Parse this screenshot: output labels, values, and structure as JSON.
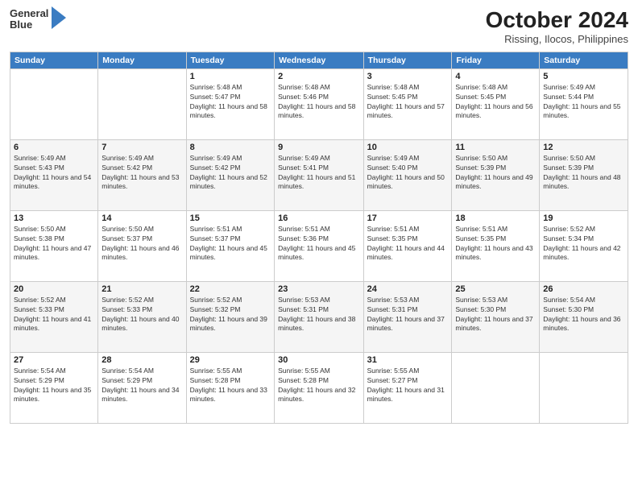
{
  "logo": {
    "line1": "General",
    "line2": "Blue"
  },
  "header": {
    "month": "October 2024",
    "location": "Rissing, Ilocos, Philippines"
  },
  "weekdays": [
    "Sunday",
    "Monday",
    "Tuesday",
    "Wednesday",
    "Thursday",
    "Friday",
    "Saturday"
  ],
  "weeks": [
    [
      {
        "day": "",
        "sunrise": "",
        "sunset": "",
        "daylight": ""
      },
      {
        "day": "",
        "sunrise": "",
        "sunset": "",
        "daylight": ""
      },
      {
        "day": "1",
        "sunrise": "Sunrise: 5:48 AM",
        "sunset": "Sunset: 5:47 PM",
        "daylight": "Daylight: 11 hours and 58 minutes."
      },
      {
        "day": "2",
        "sunrise": "Sunrise: 5:48 AM",
        "sunset": "Sunset: 5:46 PM",
        "daylight": "Daylight: 11 hours and 58 minutes."
      },
      {
        "day": "3",
        "sunrise": "Sunrise: 5:48 AM",
        "sunset": "Sunset: 5:45 PM",
        "daylight": "Daylight: 11 hours and 57 minutes."
      },
      {
        "day": "4",
        "sunrise": "Sunrise: 5:48 AM",
        "sunset": "Sunset: 5:45 PM",
        "daylight": "Daylight: 11 hours and 56 minutes."
      },
      {
        "day": "5",
        "sunrise": "Sunrise: 5:49 AM",
        "sunset": "Sunset: 5:44 PM",
        "daylight": "Daylight: 11 hours and 55 minutes."
      }
    ],
    [
      {
        "day": "6",
        "sunrise": "Sunrise: 5:49 AM",
        "sunset": "Sunset: 5:43 PM",
        "daylight": "Daylight: 11 hours and 54 minutes."
      },
      {
        "day": "7",
        "sunrise": "Sunrise: 5:49 AM",
        "sunset": "Sunset: 5:42 PM",
        "daylight": "Daylight: 11 hours and 53 minutes."
      },
      {
        "day": "8",
        "sunrise": "Sunrise: 5:49 AM",
        "sunset": "Sunset: 5:42 PM",
        "daylight": "Daylight: 11 hours and 52 minutes."
      },
      {
        "day": "9",
        "sunrise": "Sunrise: 5:49 AM",
        "sunset": "Sunset: 5:41 PM",
        "daylight": "Daylight: 11 hours and 51 minutes."
      },
      {
        "day": "10",
        "sunrise": "Sunrise: 5:49 AM",
        "sunset": "Sunset: 5:40 PM",
        "daylight": "Daylight: 11 hours and 50 minutes."
      },
      {
        "day": "11",
        "sunrise": "Sunrise: 5:50 AM",
        "sunset": "Sunset: 5:39 PM",
        "daylight": "Daylight: 11 hours and 49 minutes."
      },
      {
        "day": "12",
        "sunrise": "Sunrise: 5:50 AM",
        "sunset": "Sunset: 5:39 PM",
        "daylight": "Daylight: 11 hours and 48 minutes."
      }
    ],
    [
      {
        "day": "13",
        "sunrise": "Sunrise: 5:50 AM",
        "sunset": "Sunset: 5:38 PM",
        "daylight": "Daylight: 11 hours and 47 minutes."
      },
      {
        "day": "14",
        "sunrise": "Sunrise: 5:50 AM",
        "sunset": "Sunset: 5:37 PM",
        "daylight": "Daylight: 11 hours and 46 minutes."
      },
      {
        "day": "15",
        "sunrise": "Sunrise: 5:51 AM",
        "sunset": "Sunset: 5:37 PM",
        "daylight": "Daylight: 11 hours and 45 minutes."
      },
      {
        "day": "16",
        "sunrise": "Sunrise: 5:51 AM",
        "sunset": "Sunset: 5:36 PM",
        "daylight": "Daylight: 11 hours and 45 minutes."
      },
      {
        "day": "17",
        "sunrise": "Sunrise: 5:51 AM",
        "sunset": "Sunset: 5:35 PM",
        "daylight": "Daylight: 11 hours and 44 minutes."
      },
      {
        "day": "18",
        "sunrise": "Sunrise: 5:51 AM",
        "sunset": "Sunset: 5:35 PM",
        "daylight": "Daylight: 11 hours and 43 minutes."
      },
      {
        "day": "19",
        "sunrise": "Sunrise: 5:52 AM",
        "sunset": "Sunset: 5:34 PM",
        "daylight": "Daylight: 11 hours and 42 minutes."
      }
    ],
    [
      {
        "day": "20",
        "sunrise": "Sunrise: 5:52 AM",
        "sunset": "Sunset: 5:33 PM",
        "daylight": "Daylight: 11 hours and 41 minutes."
      },
      {
        "day": "21",
        "sunrise": "Sunrise: 5:52 AM",
        "sunset": "Sunset: 5:33 PM",
        "daylight": "Daylight: 11 hours and 40 minutes."
      },
      {
        "day": "22",
        "sunrise": "Sunrise: 5:52 AM",
        "sunset": "Sunset: 5:32 PM",
        "daylight": "Daylight: 11 hours and 39 minutes."
      },
      {
        "day": "23",
        "sunrise": "Sunrise: 5:53 AM",
        "sunset": "Sunset: 5:31 PM",
        "daylight": "Daylight: 11 hours and 38 minutes."
      },
      {
        "day": "24",
        "sunrise": "Sunrise: 5:53 AM",
        "sunset": "Sunset: 5:31 PM",
        "daylight": "Daylight: 11 hours and 37 minutes."
      },
      {
        "day": "25",
        "sunrise": "Sunrise: 5:53 AM",
        "sunset": "Sunset: 5:30 PM",
        "daylight": "Daylight: 11 hours and 37 minutes."
      },
      {
        "day": "26",
        "sunrise": "Sunrise: 5:54 AM",
        "sunset": "Sunset: 5:30 PM",
        "daylight": "Daylight: 11 hours and 36 minutes."
      }
    ],
    [
      {
        "day": "27",
        "sunrise": "Sunrise: 5:54 AM",
        "sunset": "Sunset: 5:29 PM",
        "daylight": "Daylight: 11 hours and 35 minutes."
      },
      {
        "day": "28",
        "sunrise": "Sunrise: 5:54 AM",
        "sunset": "Sunset: 5:29 PM",
        "daylight": "Daylight: 11 hours and 34 minutes."
      },
      {
        "day": "29",
        "sunrise": "Sunrise: 5:55 AM",
        "sunset": "Sunset: 5:28 PM",
        "daylight": "Daylight: 11 hours and 33 minutes."
      },
      {
        "day": "30",
        "sunrise": "Sunrise: 5:55 AM",
        "sunset": "Sunset: 5:28 PM",
        "daylight": "Daylight: 11 hours and 32 minutes."
      },
      {
        "day": "31",
        "sunrise": "Sunrise: 5:55 AM",
        "sunset": "Sunset: 5:27 PM",
        "daylight": "Daylight: 11 hours and 31 minutes."
      },
      {
        "day": "",
        "sunrise": "",
        "sunset": "",
        "daylight": ""
      },
      {
        "day": "",
        "sunrise": "",
        "sunset": "",
        "daylight": ""
      }
    ]
  ]
}
